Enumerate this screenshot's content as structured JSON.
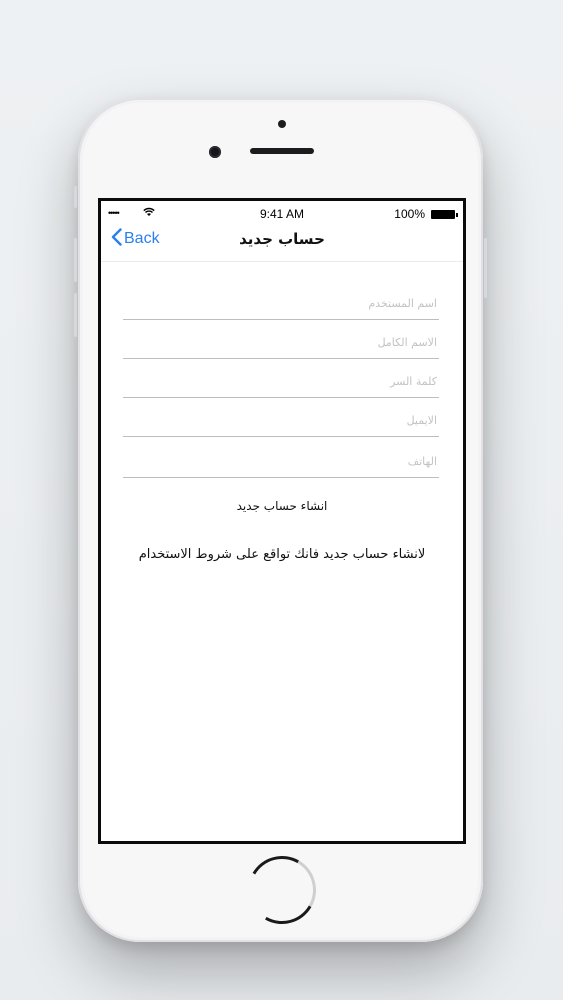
{
  "status_bar": {
    "signal": "•••••",
    "time": "9:41 AM",
    "battery": "100%"
  },
  "nav": {
    "back_label": "Back",
    "title": "حساب جديد"
  },
  "form": {
    "fields": [
      {
        "placeholder": "اسم المستخدم",
        "value": ""
      },
      {
        "placeholder": "الاسم الكامل",
        "value": ""
      },
      {
        "placeholder": "كلمة السر",
        "value": ""
      },
      {
        "placeholder": "الايميل",
        "value": ""
      },
      {
        "placeholder": "الهاتف",
        "value": ""
      }
    ],
    "submit_label": "انشاء حساب جديد",
    "terms_text": "لانشاء حساب جديد فانك تواقع على شروط الاستخدام"
  },
  "colors": {
    "accent": "#2b7ff0",
    "screen_border": "#0b0b0d",
    "phone_body": "#f7f7f8"
  },
  "icons": [
    "wifi-icon",
    "battery-icon",
    "back-chevron-icon",
    "home-button-icon"
  ]
}
